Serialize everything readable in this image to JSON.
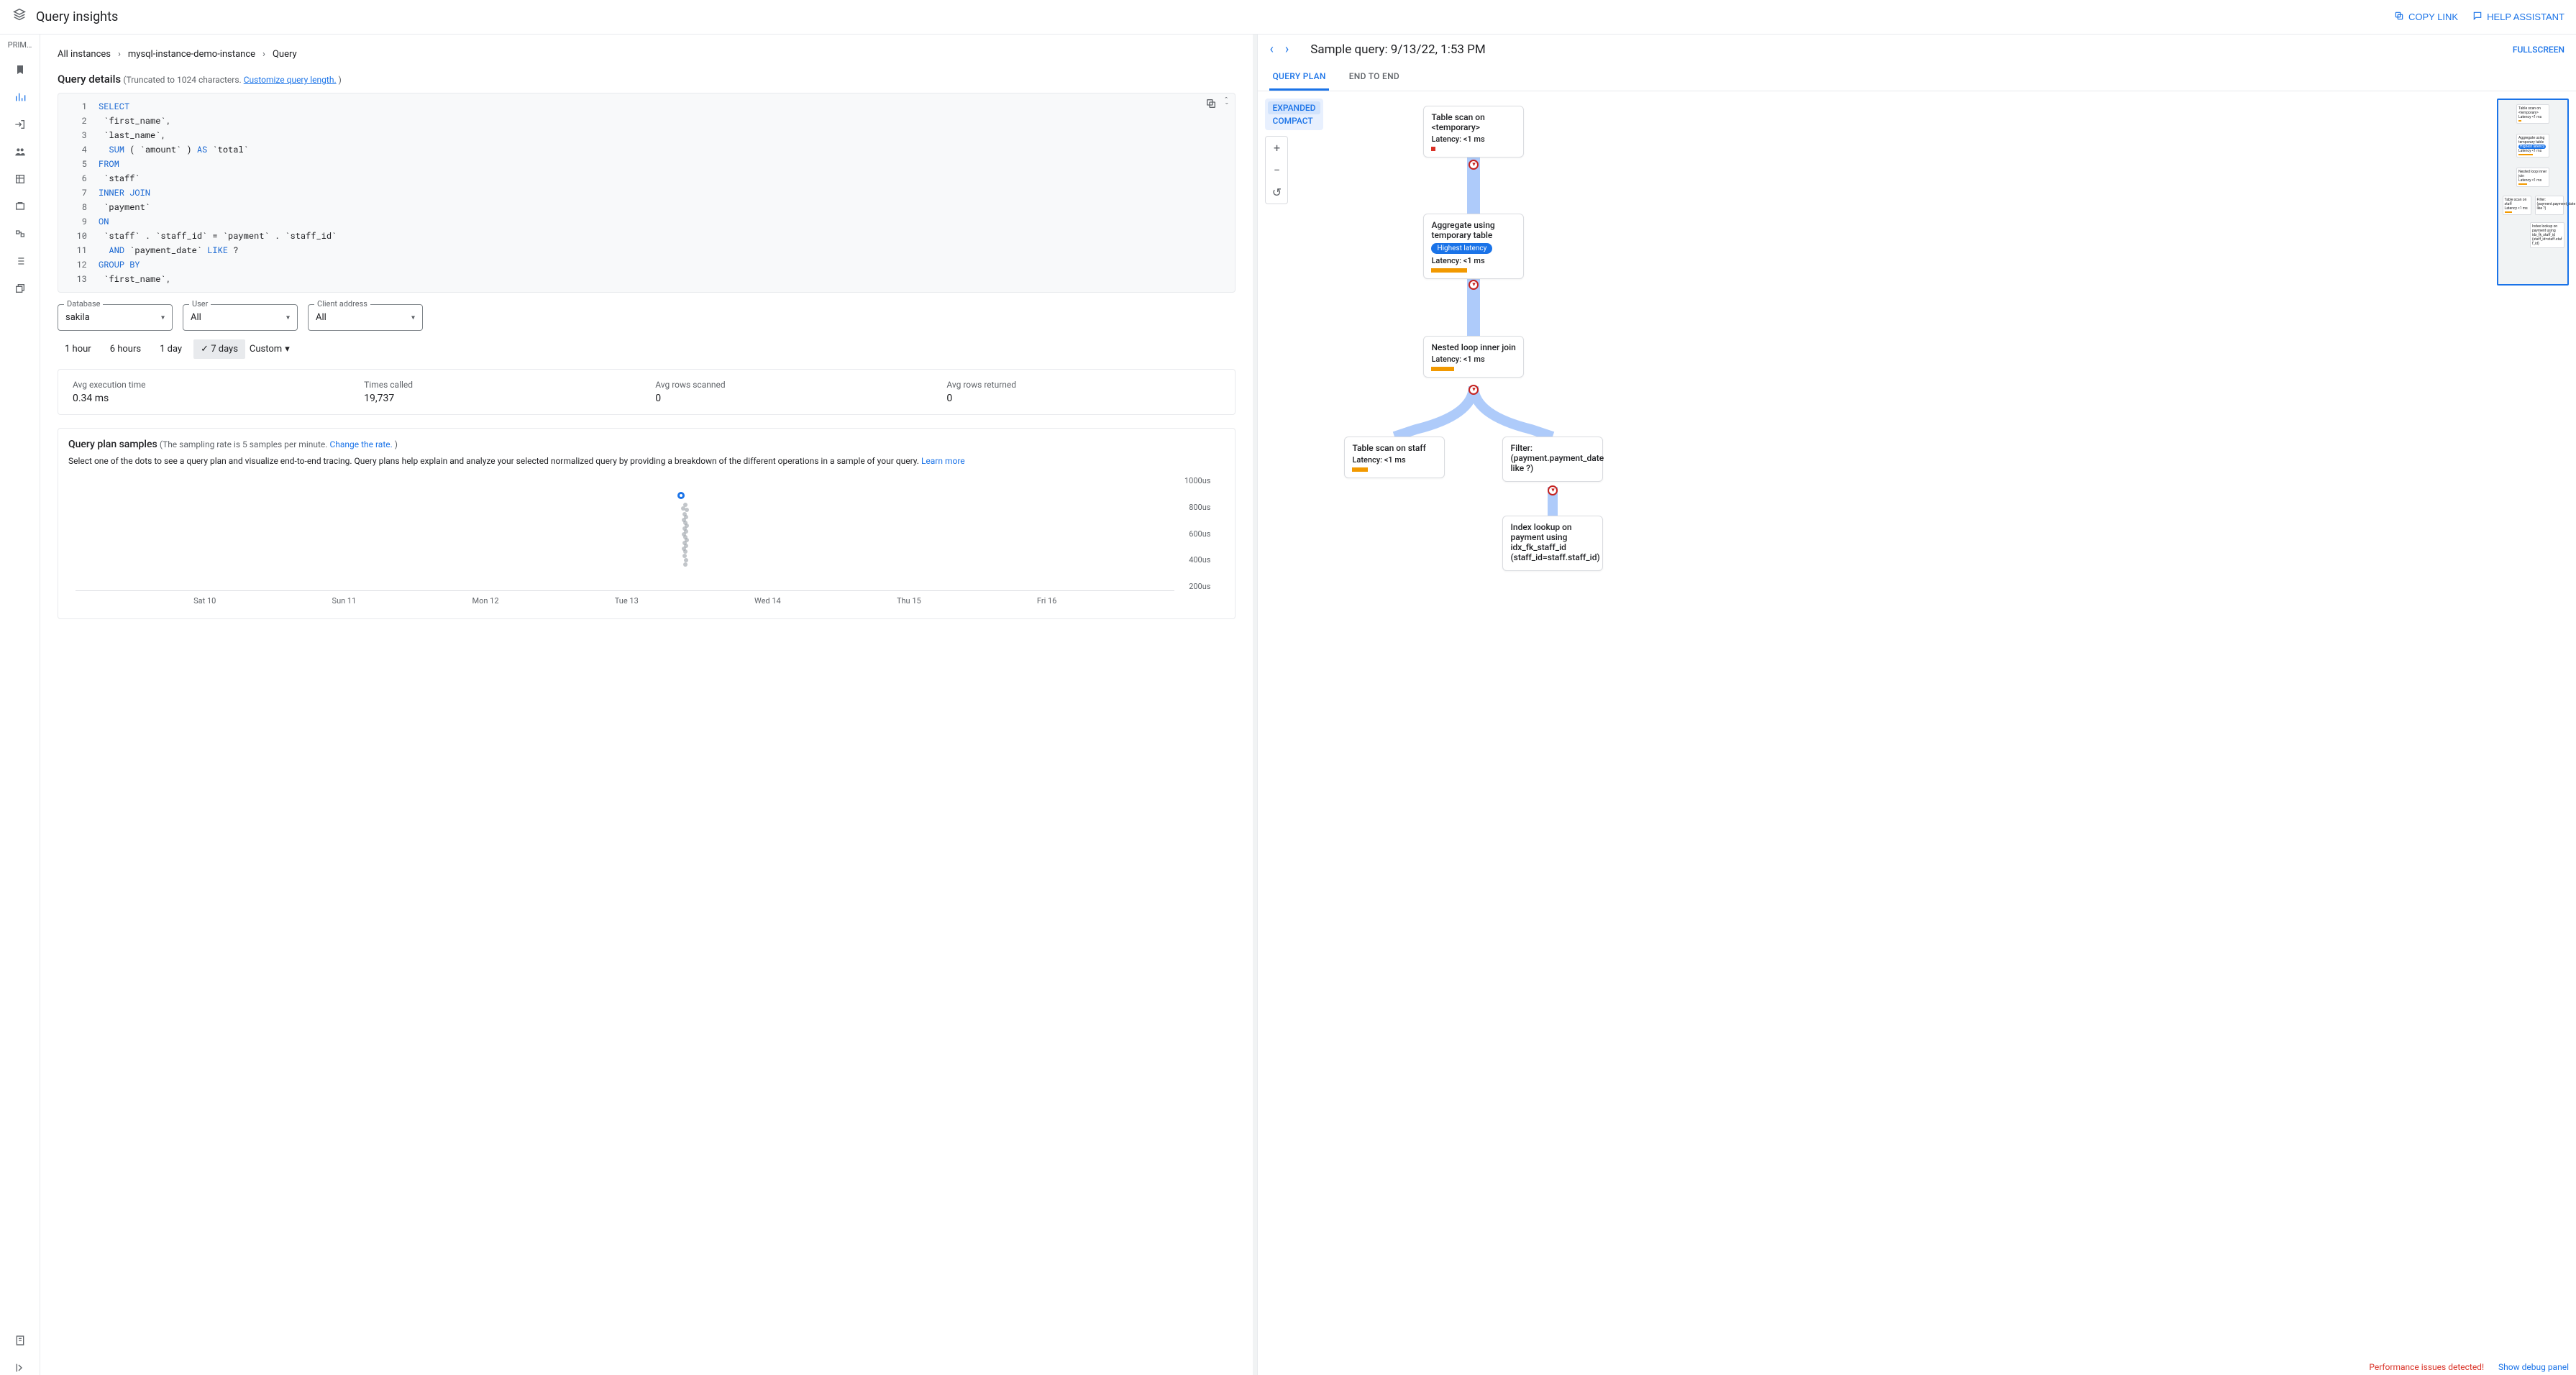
{
  "header": {
    "title": "Query insights",
    "copy_link": "COPY LINK",
    "help": "HELP ASSISTANT"
  },
  "nav": {
    "project": "PRIM…"
  },
  "breadcrumb": {
    "all": "All instances",
    "inst": "mysql-instance-demo-instance",
    "query": "Query"
  },
  "details": {
    "title": "Query details",
    "truncated": "(Truncated to 1024 characters.",
    "customize": "Customize query length.",
    "close": ")"
  },
  "code": {
    "lines": [
      "SELECT",
      "  `first_name`,",
      "  `last_name`,",
      "  SUM ( `amount` ) AS `total`",
      "FROM",
      "  `staff`",
      "INNER JOIN",
      "  `payment`",
      "ON",
      "  `staff` . `staff_id` = `payment` . `staff_id`",
      "  AND `payment_date` LIKE ?",
      "GROUP BY",
      "  `first_name`,"
    ]
  },
  "filters": {
    "db_label": "Database",
    "db_value": "sakila",
    "user_label": "User",
    "user_value": "All",
    "addr_label": "Client address",
    "addr_value": "All"
  },
  "time": {
    "h1": "1 hour",
    "h6": "6 hours",
    "d1": "1 day",
    "d7": "7 days",
    "custom": "Custom"
  },
  "stats": {
    "exec_l": "Avg execution time",
    "exec_v": "0.34 ms",
    "times_l": "Times called",
    "times_v": "19,737",
    "scan_l": "Avg rows scanned",
    "scan_v": "0",
    "ret_l": "Avg rows returned",
    "ret_v": "0"
  },
  "samples": {
    "title": "Query plan samples",
    "rate": "(The sampling rate is 5 samples per minute.",
    "change": "Change the rate.",
    "close": ")",
    "desc1": "Select one of the dots to see a query plan and visualize end-to-end tracing. Query plans help explain and analyze your selected normalized query by providing a breakdown of the different operations in a sample of your query.",
    "learn": "Learn more"
  },
  "chart_data": {
    "type": "scatter",
    "xlabel": "",
    "ylabel": "",
    "x_ticks": [
      "Sat 10",
      "Sun 11",
      "Mon 12",
      "Tue 13",
      "Wed 14",
      "Thu 15",
      "Fri 16"
    ],
    "y_ticks": [
      "200us",
      "400us",
      "600us",
      "800us",
      "1000us"
    ],
    "selected": {
      "day": "Tue 13",
      "value_us": 800
    },
    "cluster": {
      "day_between": [
        "Tue 13",
        "Wed 14"
      ],
      "range_us": [
        250,
        700
      ],
      "count_approx": 35
    }
  },
  "sample_header": {
    "title": "Sample query: 9/13/22, 1:53 PM",
    "fullscreen": "FULLSCREEN"
  },
  "plan_tabs": {
    "plan": "QUERY PLAN",
    "e2e": "END TO END"
  },
  "plan_toggle": {
    "expanded": "EXPANDED",
    "compact": "COMPACT"
  },
  "nodes": {
    "n1": {
      "t": "Table scan on <temporary>",
      "lat": "Latency: <1 ms"
    },
    "n2": {
      "t": "Aggregate using temporary table",
      "badge": "Highest latency",
      "lat": "Latency: <1 ms"
    },
    "n3": {
      "t": "Nested loop inner join",
      "lat": "Latency: <1 ms"
    },
    "n4": {
      "t": "Table scan on staff",
      "lat": "Latency: <1 ms"
    },
    "n5": {
      "t": "Filter: (payment.payment_date like ?)"
    },
    "n6": {
      "t": "Index lookup on payment using idx_fk_staff_id (staff_id=staff.staff_id)"
    }
  },
  "footer": {
    "warn": "Performance issues detected!",
    "debug": "Show debug panel"
  }
}
